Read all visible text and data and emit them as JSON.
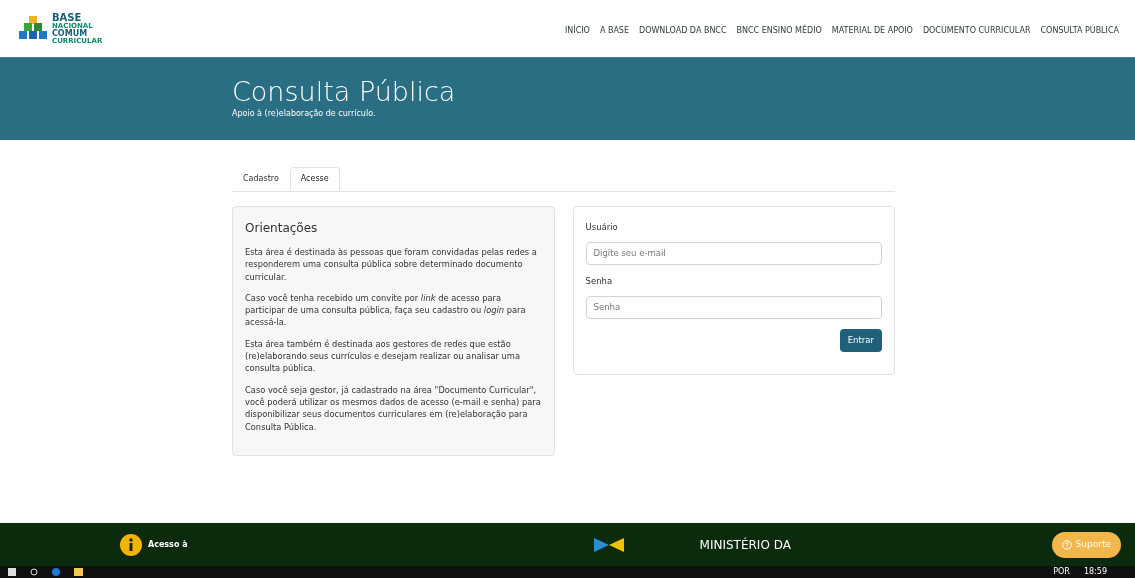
{
  "header": {
    "logo": {
      "line1": "BASE",
      "line2": "NACIONAL",
      "line3": "COMUM",
      "line4": "CURRICULAR"
    },
    "nav": [
      {
        "label": "INÍCIO"
      },
      {
        "label": "A BASE"
      },
      {
        "label": "DOWNLOAD DA BNCC"
      },
      {
        "label": "BNCC ENSINO MÉDIO"
      },
      {
        "label": "MATERIAL DE APOIO"
      },
      {
        "label": "DOCUMENTO CURRICULAR"
      },
      {
        "label": "CONSULTA PÚBLICA"
      }
    ]
  },
  "banner": {
    "title": "Consulta Pública",
    "subtitle": "Apoio à (re)elaboração de currículo."
  },
  "tabs": [
    {
      "label": "Cadastro",
      "selected": false
    },
    {
      "label": "Acesse",
      "selected": true
    }
  ],
  "guidance": {
    "title": "Orientações",
    "paragraphs": [
      "Esta área é destinada às pessoas que foram convidadas pelas redes a responderem uma consulta pública sobre determinado documento curricular.",
      "Caso você tenha recebido um convite por *link* de acesso para participar de uma consulta pública, faça seu cadastro ou *login* para acessá-la.",
      "Esta área também é destinada aos gestores de redes que estão (re)elaborando seus currículos e desejam realizar ou analisar uma consulta pública.",
      "Caso você seja gestor, já cadastrado na área \"Documento Curricular\", você poderá utilizar os mesmos dados de acesso (e-mail e senha) para disponibilizar seus documentos curriculares em (re)elaboração para Consulta Pública."
    ]
  },
  "login": {
    "fields": [
      {
        "label": "Usuário",
        "placeholder": "Digite seu e-mail"
      },
      {
        "label": "Senha",
        "placeholder": "Senha"
      }
    ],
    "submit": "Entrar"
  },
  "footer": {
    "access_label": "Acesso à",
    "ministry": "MINISTÉRIO DA",
    "support": "Suporte"
  },
  "taskbar": {
    "language": "POR",
    "time": "18:59"
  }
}
